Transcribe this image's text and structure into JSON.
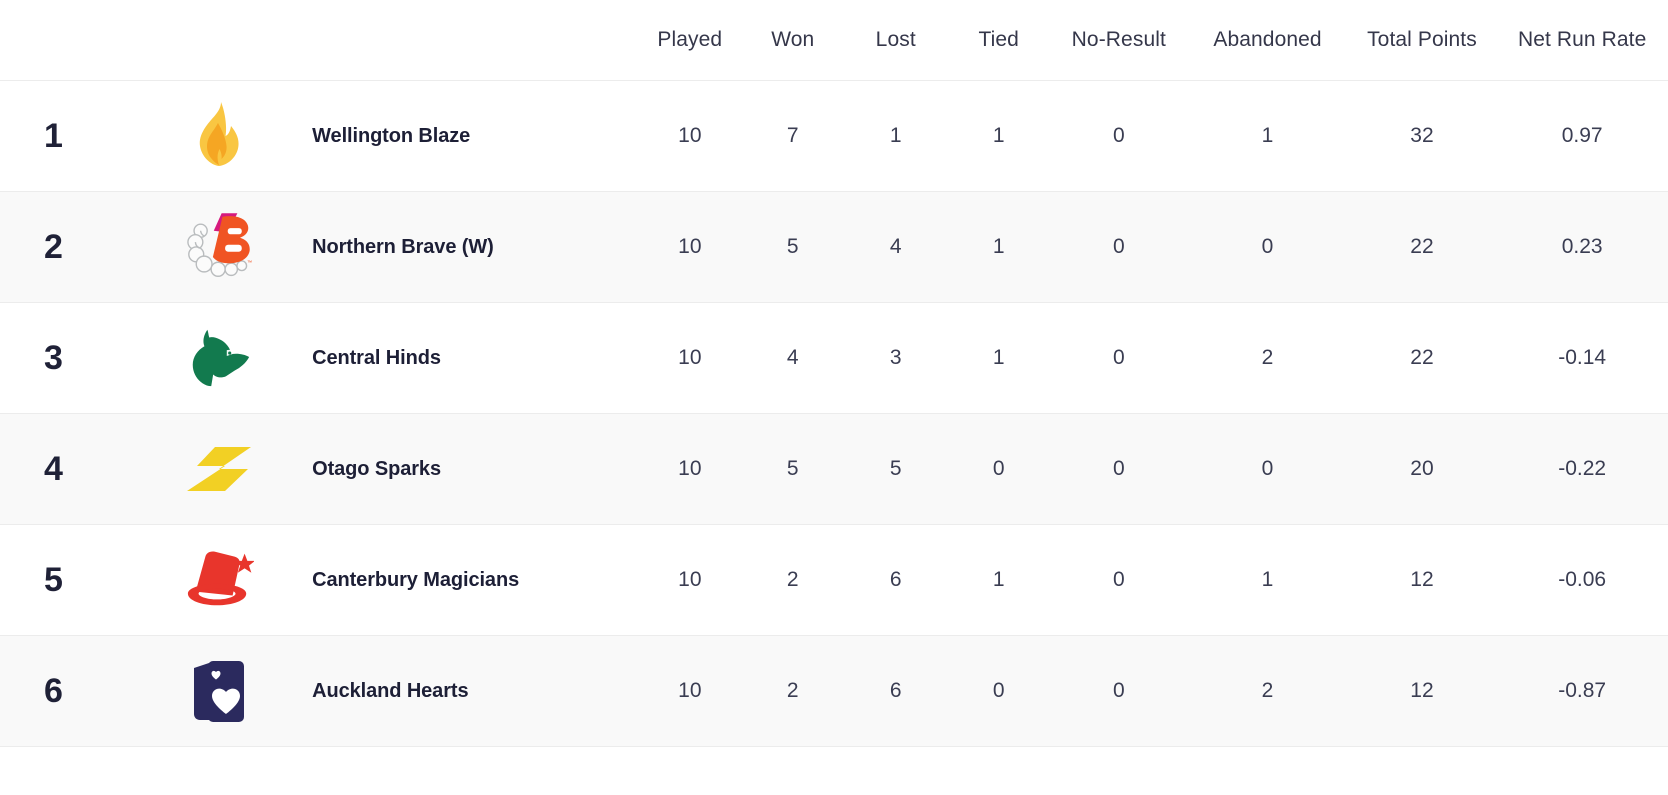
{
  "table": {
    "columns": [
      {
        "key": "rank",
        "label": "",
        "class": "col-rank"
      },
      {
        "key": "logo",
        "label": "",
        "class": "col-logo"
      },
      {
        "key": "team",
        "label": "",
        "class": "col-team"
      },
      {
        "key": "played",
        "label": "Played",
        "class": "col-stat"
      },
      {
        "key": "won",
        "label": "Won",
        "class": "col-stat"
      },
      {
        "key": "lost",
        "label": "Lost",
        "class": "col-stat"
      },
      {
        "key": "tied",
        "label": "Tied",
        "class": "col-stat"
      },
      {
        "key": "noresult",
        "label": "No-Result",
        "class": "col-nores"
      },
      {
        "key": "abandoned",
        "label": "Abandoned",
        "class": "col-aband"
      },
      {
        "key": "points",
        "label": "Total Points",
        "class": "col-points"
      },
      {
        "key": "nrr",
        "label": "Net Run Rate",
        "class": "col-nrr"
      }
    ],
    "headers": {
      "played": "Played",
      "won": "Won",
      "lost": "Lost",
      "tied": "Tied",
      "noresult": "No-Result",
      "abandoned": "Abandoned",
      "points": "Total Points",
      "nrr": "Net Run Rate"
    },
    "rows": [
      {
        "rank": "1",
        "team": "Wellington Blaze",
        "logo": "flame-icon",
        "played": "10",
        "won": "7",
        "lost": "1",
        "tied": "1",
        "noresult": "0",
        "abandoned": "1",
        "points": "32",
        "nrr": "0.97"
      },
      {
        "rank": "2",
        "team": "Northern Brave (W)",
        "logo": "brave-b-icon",
        "played": "10",
        "won": "5",
        "lost": "4",
        "tied": "1",
        "noresult": "0",
        "abandoned": "0",
        "points": "22",
        "nrr": "0.23"
      },
      {
        "rank": "3",
        "team": "Central Hinds",
        "logo": "hind-head-icon",
        "played": "10",
        "won": "4",
        "lost": "3",
        "tied": "1",
        "noresult": "0",
        "abandoned": "2",
        "points": "22",
        "nrr": "-0.14"
      },
      {
        "rank": "4",
        "team": "Otago Sparks",
        "logo": "lightning-s-icon",
        "played": "10",
        "won": "5",
        "lost": "5",
        "tied": "0",
        "noresult": "0",
        "abandoned": "0",
        "points": "20",
        "nrr": "-0.22"
      },
      {
        "rank": "5",
        "team": "Canterbury Magicians",
        "logo": "top-hat-star-icon",
        "played": "10",
        "won": "2",
        "lost": "6",
        "tied": "1",
        "noresult": "0",
        "abandoned": "1",
        "points": "12",
        "nrr": "-0.06"
      },
      {
        "rank": "6",
        "team": "Auckland Hearts",
        "logo": "playing-cards-heart-icon",
        "played": "10",
        "won": "2",
        "lost": "6",
        "tied": "0",
        "noresult": "0",
        "abandoned": "2",
        "points": "12",
        "nrr": "-0.87"
      }
    ]
  },
  "colors": {
    "flame_light": "#f9c642",
    "flame_dark": "#f5a623",
    "brave_orange": "#f05423",
    "brave_magenta": "#d6197d",
    "brave_ball": "#b9bcbe",
    "hinds_green": "#127a4e",
    "sparks_yellow": "#f2d024",
    "magicians_red": "#e8352c",
    "hearts_navy": "#2b2a5e",
    "row_alt": "#f9f9f9",
    "border": "#ececec",
    "text_dark": "#1d1f36",
    "text_stat": "#3a3d52"
  }
}
